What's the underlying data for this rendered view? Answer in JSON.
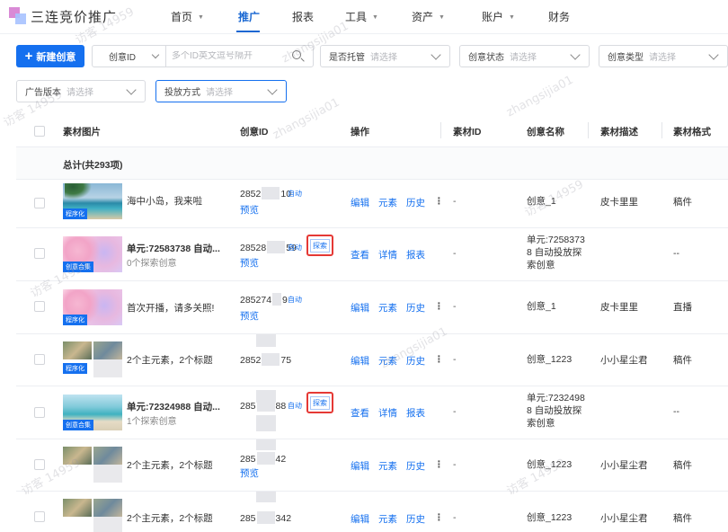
{
  "app": {
    "logo_text": "三连竞价推广"
  },
  "nav": {
    "items": [
      {
        "label": "首页",
        "caret": true
      },
      {
        "label": "推广",
        "caret": false,
        "active": true
      },
      {
        "label": "报表",
        "caret": false
      },
      {
        "label": "工具",
        "caret": true
      },
      {
        "label": "资产",
        "caret": true
      },
      {
        "label": "账户",
        "caret": true
      },
      {
        "label": "财务",
        "caret": false
      }
    ],
    "caret_glyph": "▼"
  },
  "filters": {
    "new_button": {
      "plus": "+",
      "label": "新建创意"
    },
    "search_select": "创意ID",
    "search_placeholder": "多个ID英文逗号隔开",
    "hosting": {
      "label": "是否托管",
      "placeholder": "请选择"
    },
    "status": {
      "label": "创意状态",
      "placeholder": "请选择"
    },
    "ctype": {
      "label": "创意类型",
      "placeholder": "请选择"
    },
    "ad_version": {
      "label": "广告版本",
      "placeholder": "请选择"
    },
    "delivery": {
      "label": "投放方式",
      "placeholder": "请选择"
    }
  },
  "table": {
    "headers": {
      "image": "素材图片",
      "creative_id": "创意ID",
      "ops": "操作",
      "material_id": "素材ID",
      "creative_name": "创意名称",
      "material_desc": "素材描述",
      "material_format": "素材格式"
    },
    "total": "总计(共293项)",
    "rows": [
      {
        "tag": "程序化",
        "title": "海中小岛，我来啦",
        "sub": "",
        "cid_a": "2852",
        "cid_b": "10",
        "cid_tag": "自动",
        "preview": "预览",
        "ops": [
          "编辑",
          "元素",
          "历史"
        ],
        "more": "⋮",
        "material_id": "-",
        "name": "创意_1",
        "desc": "皮卡里里",
        "fmt": "稿件"
      },
      {
        "tag": "创意合集",
        "title": "单元:72583738 自动...",
        "sub": "0个探索创意",
        "cid_a": "28528",
        "cid_b": "59",
        "cid_tag": "自动",
        "explore": "探索",
        "preview": "预览",
        "ops": [
          "查看",
          "详情",
          "报表"
        ],
        "more": "",
        "material_id": "-",
        "name": "单元:7258373\n8 自动投放探\n索创意",
        "desc": "",
        "fmt": "--"
      },
      {
        "tag": "程序化",
        "title": "首次开播，请多关照!",
        "sub": "",
        "cid_a": "285274",
        "cid_b": "9",
        "cid_tag": "自动",
        "preview": "预览",
        "ops": [
          "编辑",
          "元素",
          "历史"
        ],
        "more": "⋮",
        "material_id": "-",
        "name": "创意_1",
        "desc": "皮卡里里",
        "fmt": "直播"
      },
      {
        "tag": "程序化",
        "title": "2个主元素，2个标题",
        "sub": "",
        "cid_a": "2852",
        "cid_b": "75",
        "cid_tag": "",
        "preview": "",
        "ops": [
          "编辑",
          "元素",
          "历史"
        ],
        "more": "⋮",
        "material_id": "-",
        "name": "创意_1223",
        "desc": "小小星尘君",
        "fmt": "稿件"
      },
      {
        "tag": "创意合集",
        "title": "单元:72324988 自动...",
        "sub": "1个探索创意",
        "cid_a": "285",
        "cid_b": "88",
        "cid_tag": "自动",
        "explore": "探索",
        "preview": "",
        "ops": [
          "查看",
          "详情",
          "报表"
        ],
        "more": "",
        "material_id": "-",
        "name": "单元:7232498\n8 自动投放探\n索创意",
        "desc": "",
        "fmt": "--"
      },
      {
        "tag": "",
        "title": "2个主元素，2个标题",
        "sub": "",
        "cid_a": "285",
        "cid_b": "42",
        "cid_tag": "",
        "preview": "预览",
        "ops": [
          "编辑",
          "元素",
          "历史"
        ],
        "more": "⋮",
        "material_id": "-",
        "name": "创意_1223",
        "desc": "小小星尘君",
        "fmt": "稿件"
      },
      {
        "tag": "",
        "title": "2个主元素，2个标题",
        "sub": "",
        "cid_a": "285",
        "cid_b": "342",
        "cid_tag": "",
        "preview": "",
        "ops": [
          "编辑",
          "元素",
          "历史"
        ],
        "more": "⋮",
        "material_id": "-",
        "name": "创意_1223",
        "desc": "小小星尘君",
        "fmt": "稿件"
      }
    ]
  },
  "watermark": {
    "user": "zhangsijia01",
    "visitor": "访客 14959"
  }
}
